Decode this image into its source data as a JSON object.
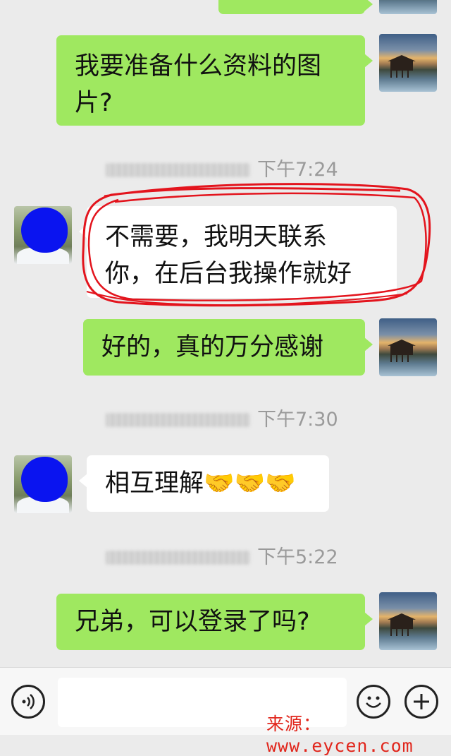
{
  "messages": [
    {
      "side": "me",
      "text": "我要准备什么资料的图\n片?"
    },
    {
      "timestamp": "下午7:24"
    },
    {
      "side": "them",
      "text": "不需要，我明天联系\n你，在后台我操作就好"
    },
    {
      "side": "me",
      "text": "好的，真的万分感谢"
    },
    {
      "timestamp": "下午7:30"
    },
    {
      "side": "them",
      "text": "相互理解🤝🤝🤝"
    },
    {
      "timestamp": "下午5:22"
    },
    {
      "side": "me",
      "text": "兄弟，可以登录了吗?"
    }
  ],
  "input_bar": {
    "voice_icon": "voice-icon",
    "emoji_icon": "emoji-icon",
    "plus_icon": "plus-icon",
    "input_value": ""
  },
  "watermark": "来源：www.eycen.com",
  "colors": {
    "background": "#ebebeb",
    "my_bubble": "#9fe860",
    "their_bubble": "#ffffff",
    "annotation": "#e3141d",
    "timestamp": "#9a9a9a"
  }
}
